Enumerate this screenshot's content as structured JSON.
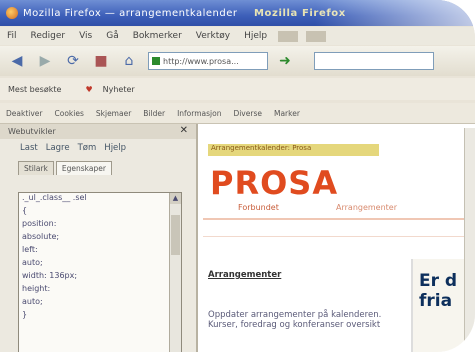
{
  "window": {
    "title": "Mozilla Firefox — arrangementkalender",
    "brand": "Mozilla Firefox"
  },
  "menubar": {
    "items": [
      "Fil",
      "Rediger",
      "Vis",
      "Gå",
      "Bokmerker",
      "Verktøy",
      "Hjelp"
    ]
  },
  "navbar": {
    "url": "http://www.prosa..."
  },
  "bookmarks": {
    "items": [
      "Mest besøkte",
      "Nyheter"
    ]
  },
  "toolbar2": {
    "items": [
      "Deaktiver",
      "Cookies",
      "Skjemaer",
      "Bilder",
      "Informasjon",
      "Diverse",
      "Marker"
    ]
  },
  "sidebar": {
    "header": "Webutvikler",
    "tools_load": "Last",
    "tools_save": "Lagre",
    "tools_clear": "Tøm",
    "tools_help": "Hjelp",
    "tab1": "Stilark",
    "tab2": "Egenskaper",
    "tree": [
      "._ul_.class__ .sel",
      "{",
      "   position:",
      "absolute;",
      "   left:",
      "auto;",
      "   width: 136px;",
      "   height:",
      "auto;",
      "}"
    ]
  },
  "content": {
    "highlight": "Arrangementkalender: Prosa",
    "logo": "PROSA",
    "logo_sub": "Forbundet",
    "logo_sub2": "Arrangementer",
    "article_title": "Arrangementer",
    "article_body": "Oppdater arrangementer på kalenderen. Kurser, foredrag og konferanser oversikt",
    "promo_line1": "Er d",
    "promo_line2": "fria"
  }
}
